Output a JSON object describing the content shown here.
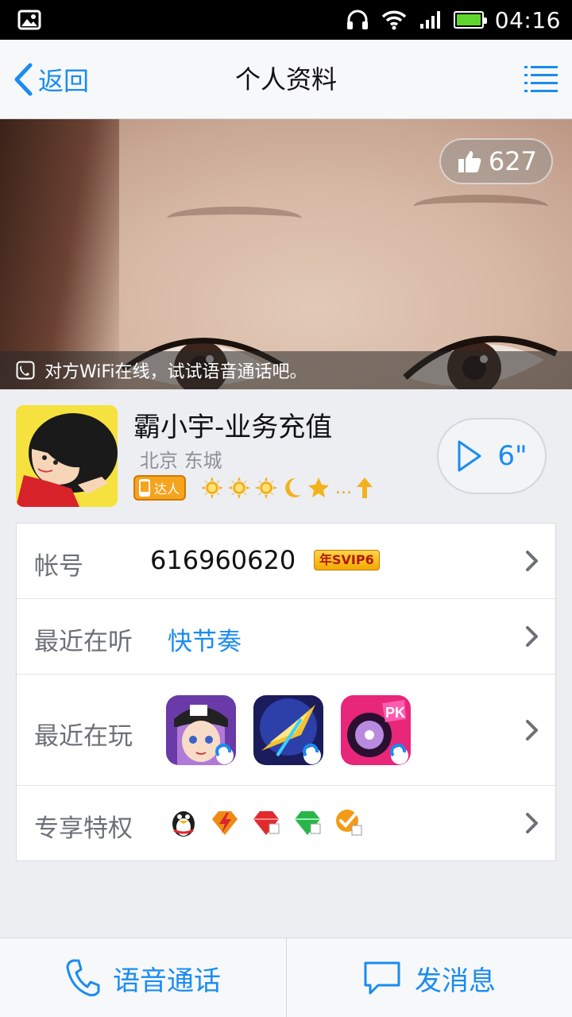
{
  "status_bar": {
    "time": "04:16"
  },
  "nav": {
    "back_label": "返回",
    "title": "个人资料"
  },
  "cover": {
    "like_count": "627",
    "banner_text": "对方WiFi在线，试试语音通话吧。"
  },
  "profile": {
    "name": "霸小宇-业务充值",
    "location": "北京 东城",
    "badge_label": "达人",
    "level_more": "...",
    "voice_duration": "6\""
  },
  "info": {
    "account": {
      "label": "帐号",
      "value": "616960620",
      "vip_badge": "年SVIP6"
    },
    "music": {
      "label": "最近在听",
      "value": "快节奏"
    },
    "games": {
      "label": "最近在玩",
      "items": [
        {
          "icon": "anime-girl-game-icon"
        },
        {
          "icon": "fighter-jet-game-icon"
        },
        {
          "icon": "music-pk-game-icon"
        }
      ]
    },
    "perks": {
      "label": "专享特权",
      "items": [
        {
          "icon": "qq-penguin-icon"
        },
        {
          "icon": "lightning-diamond-icon"
        },
        {
          "icon": "red-diamond-icon"
        },
        {
          "icon": "green-diamond-icon"
        },
        {
          "icon": "orange-check-icon"
        }
      ]
    }
  },
  "bottom": {
    "call_label": "语音通话",
    "message_label": "发消息"
  },
  "colors": {
    "accent": "#1a8cf0",
    "background": "#eceef2"
  }
}
